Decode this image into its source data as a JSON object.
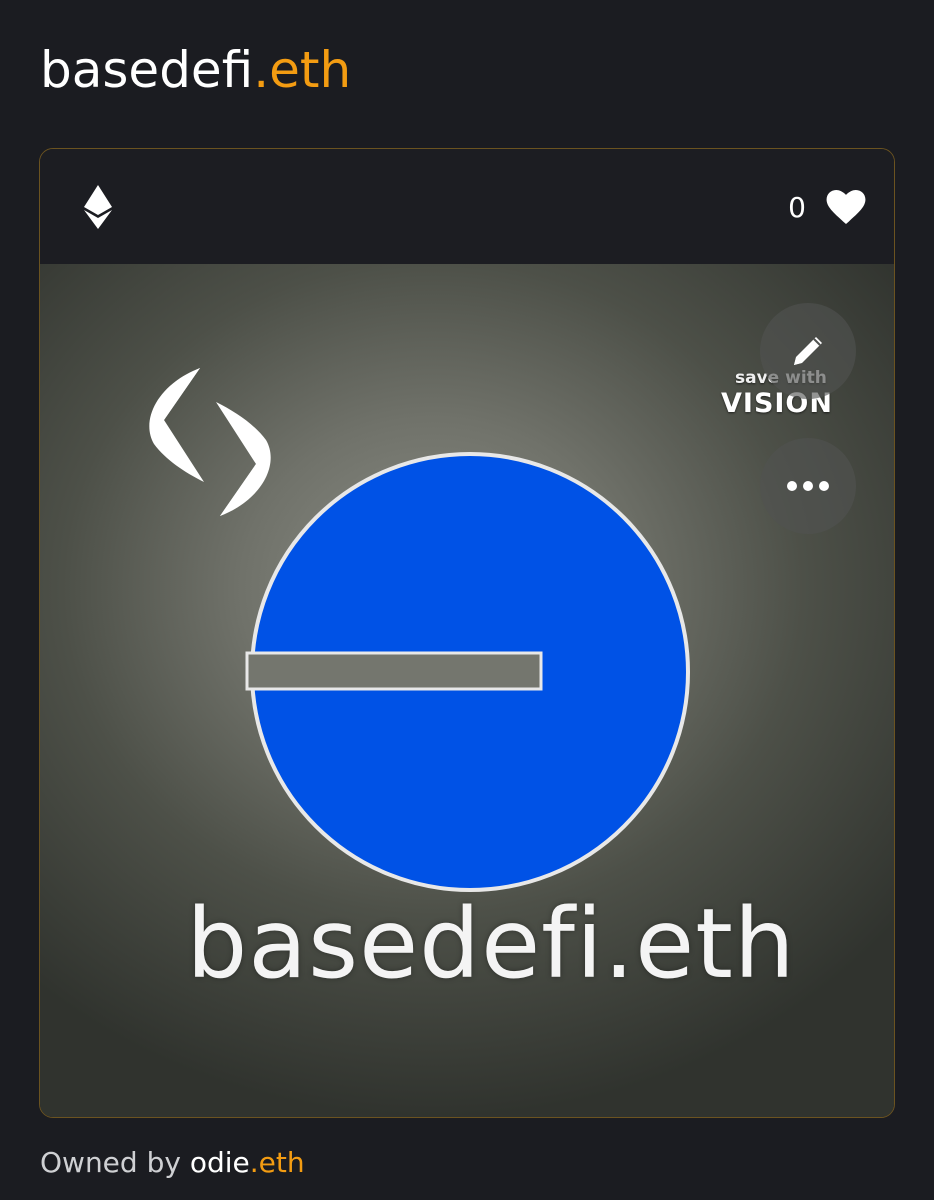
{
  "header": {
    "name_main": "basedefi",
    "name_tld": ".eth"
  },
  "card": {
    "chain_icon": "ethereum-icon",
    "like_count": "0",
    "like_icon": "heart-icon",
    "artwork": {
      "text": "basedefi.eth",
      "ens_logo_icon": "ens-logo-icon",
      "base_logo_icon": "base-logo-icon",
      "logo_color": "#0052e6"
    },
    "overlay": {
      "watermark_line1": "save with",
      "watermark_line2": "VISION",
      "edit_icon": "pencil-icon",
      "more_icon": "more-dots-icon"
    }
  },
  "ownership": {
    "prefix": "Owned by ",
    "owner_main": "odie",
    "owner_tld": ".eth"
  },
  "colors": {
    "background": "#1b1c21",
    "accent": "#f39c12",
    "card_border": "#6b5320",
    "text": "#ffffff"
  }
}
